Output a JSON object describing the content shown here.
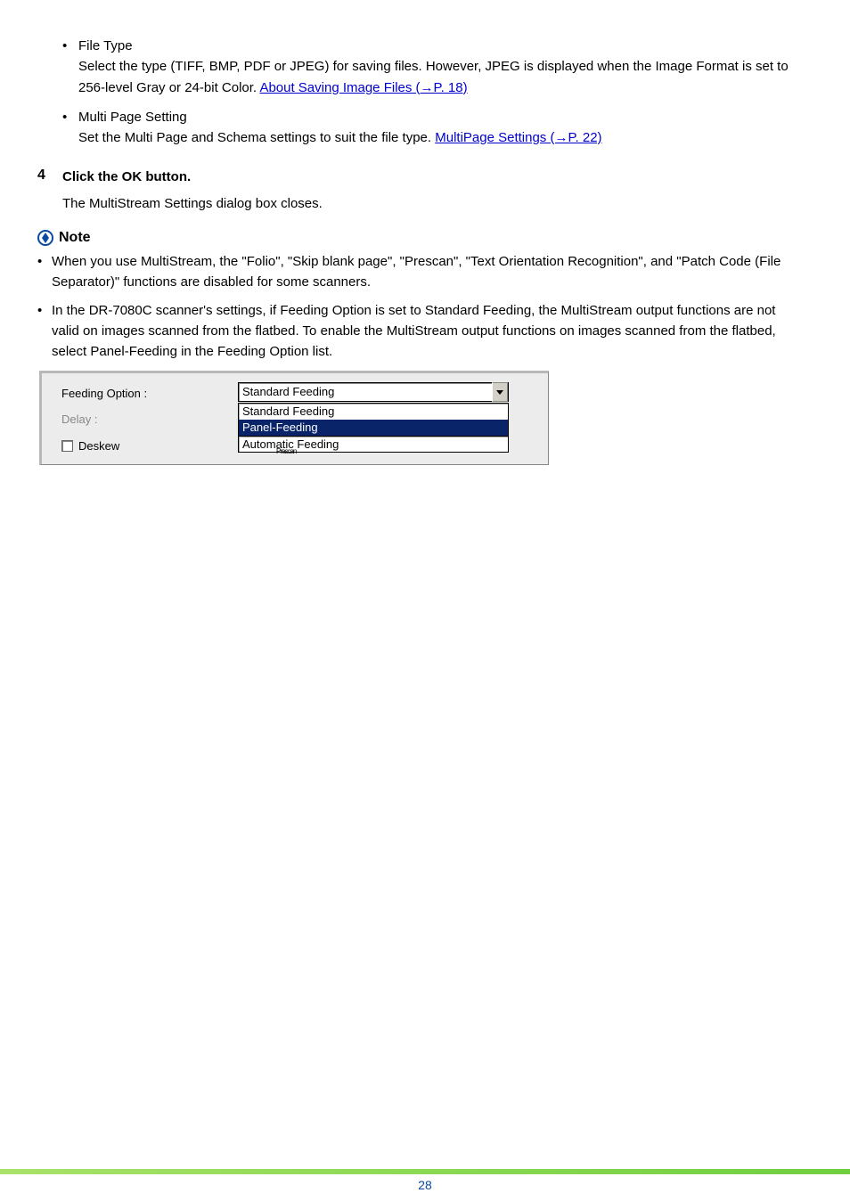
{
  "bullets": [
    {
      "title": "File Type",
      "body_pre": "Select the type (TIFF, BMP, PDF or JPEG) for saving files. However, JPEG is displayed when the Image Format is set to 256-level Gray or 24-bit Color. ",
      "link": "About Saving Image Files (→P. 18)"
    },
    {
      "title": "Multi Page Setting",
      "body_pre": "Set the Multi Page and Schema settings to suit the file type. ",
      "link": "MultiPage Settings (→P. 22)"
    }
  ],
  "step": {
    "num": "4",
    "title": "Click the OK button.",
    "desc": "The MultiStream Settings dialog box closes."
  },
  "note": {
    "title": "Note",
    "items": [
      "When you use MultiStream, the \"Folio\", \"Skip blank page\", \"Prescan\", \"Text Orientation Recognition\", and \"Patch Code (File Separator)\" functions are disabled for some scanners.",
      "In the DR-7080C scanner's settings, if Feeding Option is set to Standard Feeding, the MultiStream output functions are not valid on images scanned from the flatbed. To enable the MultiStream output functions on images scanned from the flatbed, select Panel-Feeding in the Feeding Option list."
    ]
  },
  "screenshot": {
    "label_feeding": "Feeding Option :",
    "label_delay": "Delay :",
    "label_deskew": "Deskew",
    "combo_value": "Standard Feeding",
    "drop_items": [
      "Standard Feeding",
      "Panel-Feeding"
    ],
    "drop_extra": "Automatic Feeding",
    "strike_text": "Prescan"
  },
  "page_number": "28"
}
